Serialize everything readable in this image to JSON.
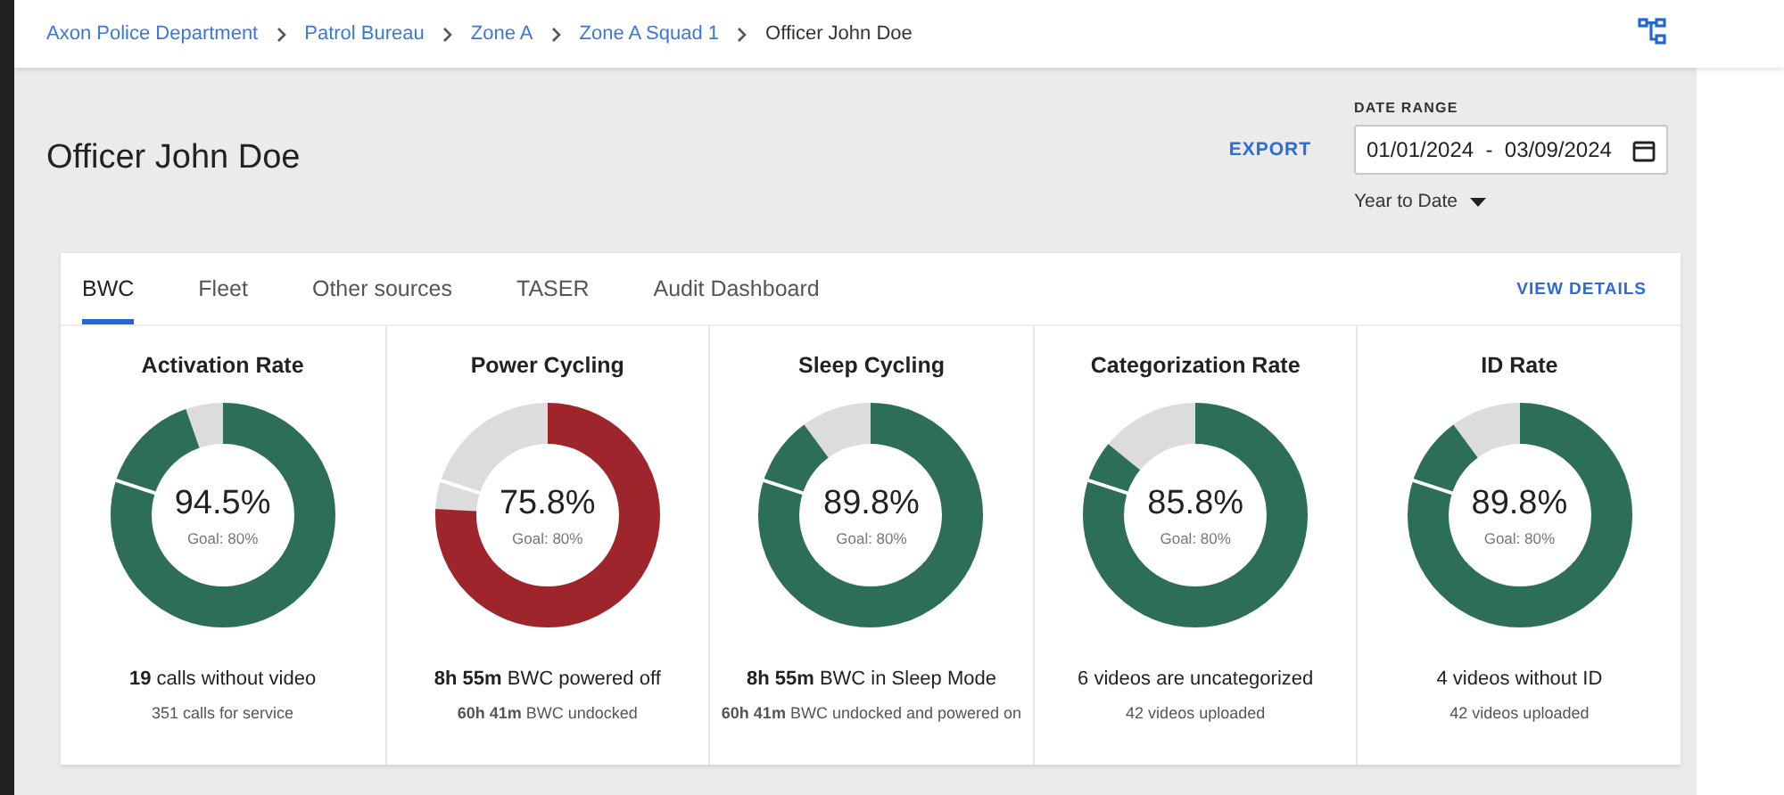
{
  "breadcrumbs": [
    {
      "label": "Axon Police Department",
      "current": false
    },
    {
      "label": "Patrol Bureau",
      "current": false
    },
    {
      "label": "Zone A",
      "current": false
    },
    {
      "label": "Zone A Squad 1",
      "current": false
    },
    {
      "label": "Officer John Doe",
      "current": true
    }
  ],
  "page_title": "Officer John Doe",
  "export_label": "EXPORT",
  "date_range": {
    "label": "DATE RANGE",
    "value": "01/01/2024  -  03/09/2024",
    "preset": "Year to Date"
  },
  "tabs": [
    {
      "label": "BWC",
      "selected": true
    },
    {
      "label": "Fleet",
      "selected": false
    },
    {
      "label": "Other sources",
      "selected": false
    },
    {
      "label": "TASER",
      "selected": false
    },
    {
      "label": "Audit Dashboard",
      "selected": false
    }
  ],
  "view_details_label": "VIEW DETAILS",
  "metrics": [
    {
      "title": "Activation Rate",
      "level": 0.945,
      "reading": "94.5%",
      "color": "#2d6e58",
      "goal": "Goal: 80%",
      "summary": "**19** calls without video",
      "detail": "351 calls for service"
    },
    {
      "title": "Power Cycling",
      "level": 0.758,
      "reading": "75.8%",
      "color": "#9e252b",
      "goal": "Goal: 80%",
      "summary": "**8h 55m** BWC powered off",
      "detail": "**60h 41m** BWC undocked"
    },
    {
      "title": "Sleep Cycling",
      "level": 0.898,
      "reading": "89.8%",
      "color": "#2d6e58",
      "goal": "Goal: 80%",
      "summary": "**8h 55m** BWC in Sleep Mode",
      "detail": "**60h 41m** BWC undocked and powered on"
    },
    {
      "title": "Categorization Rate",
      "level": 0.858,
      "reading": "85.8%",
      "color": "#2d6e58",
      "goal": "Goal: 80%",
      "summary": "6 videos are uncategorized",
      "detail": "42 videos uploaded"
    },
    {
      "title": "ID Rate",
      "level": 0.898,
      "reading": "89.8%",
      "color": "#2d6e58",
      "goal": "Goal: 80%",
      "summary": "4 videos without ID",
      "detail": "42 videos uploaded"
    }
  ]
}
